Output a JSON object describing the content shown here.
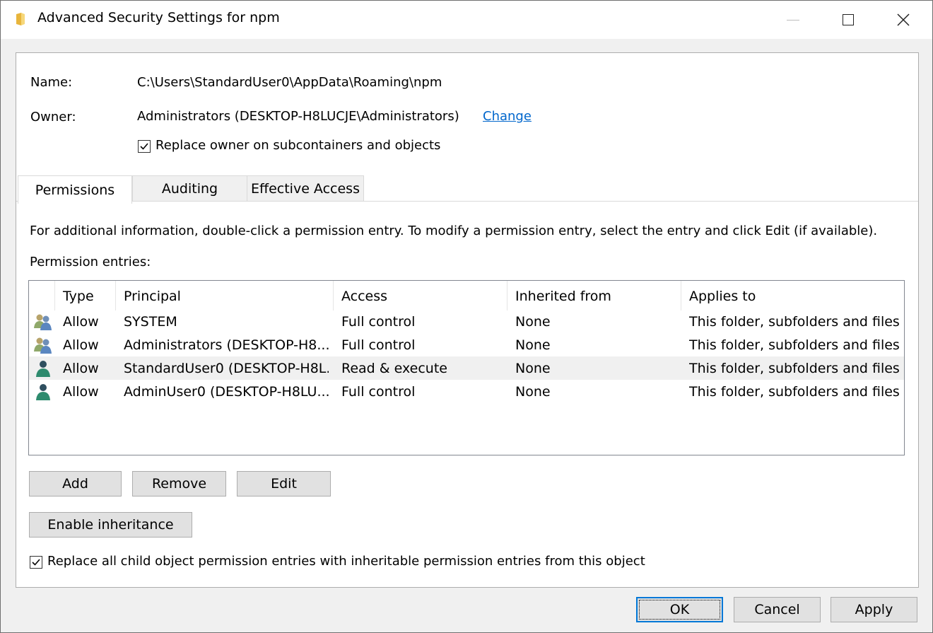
{
  "window": {
    "title": "Advanced Security Settings for npm",
    "icons": {
      "app": "folder-icon",
      "minimize": "minimize-icon",
      "maximize": "maximize-icon",
      "close": "close-icon"
    }
  },
  "info": {
    "name_label": "Name:",
    "name_value": "C:\\Users\\StandardUser0\\AppData\\Roaming\\npm",
    "owner_label": "Owner:",
    "owner_value": "Administrators (DESKTOP-H8LUCJE\\Administrators)",
    "change_link": "Change",
    "replace_owner_label": "Replace owner on subcontainers and objects",
    "replace_owner_checked": true
  },
  "tabs": [
    {
      "label": "Permissions",
      "active": true
    },
    {
      "label": "Auditing",
      "active": false
    },
    {
      "label": "Effective Access",
      "active": false
    }
  ],
  "permissions": {
    "info_text": "For additional information, double-click a permission entry. To modify a permission entry, select the entry and click Edit (if available).",
    "entries_label": "Permission entries:",
    "columns": [
      "Type",
      "Principal",
      "Access",
      "Inherited from",
      "Applies to"
    ],
    "rows": [
      {
        "icon": "group-users-icon",
        "type": "Allow",
        "principal": "SYSTEM",
        "access": "Full control",
        "inherited": "None",
        "applies": "This folder, subfolders and files",
        "selected": false
      },
      {
        "icon": "group-users-icon",
        "type": "Allow",
        "principal": "Administrators (DESKTOP-H8...",
        "access": "Full control",
        "inherited": "None",
        "applies": "This folder, subfolders and files",
        "selected": false
      },
      {
        "icon": "user-icon",
        "type": "Allow",
        "principal": "StandardUser0 (DESKTOP-H8L...",
        "access": "Read & execute",
        "inherited": "None",
        "applies": "This folder, subfolders and files",
        "selected": true
      },
      {
        "icon": "user-icon",
        "type": "Allow",
        "principal": "AdminUser0 (DESKTOP-H8LU...",
        "access": "Full control",
        "inherited": "None",
        "applies": "This folder, subfolders and files",
        "selected": false
      }
    ],
    "buttons": {
      "add": "Add",
      "remove": "Remove",
      "edit": "Edit",
      "enable_inheritance": "Enable inheritance"
    },
    "replace_child_label": "Replace all child object permission entries with inheritable permission entries from this object",
    "replace_child_checked": true
  },
  "footer": {
    "ok": "OK",
    "cancel": "Cancel",
    "apply": "Apply"
  },
  "colors": {
    "link": "#0066cc",
    "focus": "#0078d7",
    "selected_row": "#f0f0f0"
  }
}
